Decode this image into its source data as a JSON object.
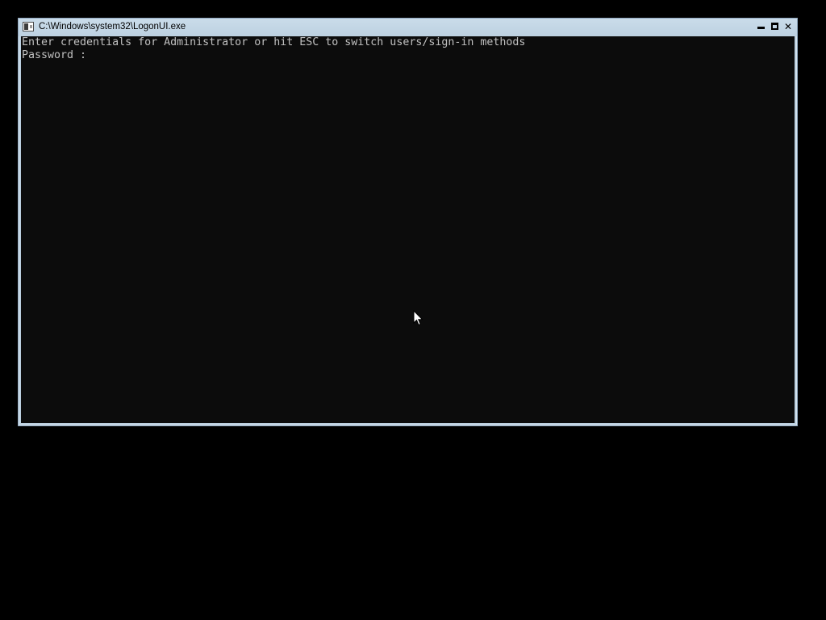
{
  "window": {
    "title": "C:\\Windows\\system32\\LogonUI.exe",
    "icon": "console-app-icon",
    "controls": {
      "minimize": "minimize-icon",
      "maximize": "maximize-icon",
      "close": "✕"
    }
  },
  "console": {
    "prompt_line": "Enter credentials for Administrator or hit ESC to switch users/sign-in methods",
    "password_label": "Password : ",
    "password_value": "",
    "text_color": "#c0c0c0",
    "background_color": "#0c0c0c"
  },
  "cursor": {
    "icon": "mouse-pointer-icon"
  }
}
